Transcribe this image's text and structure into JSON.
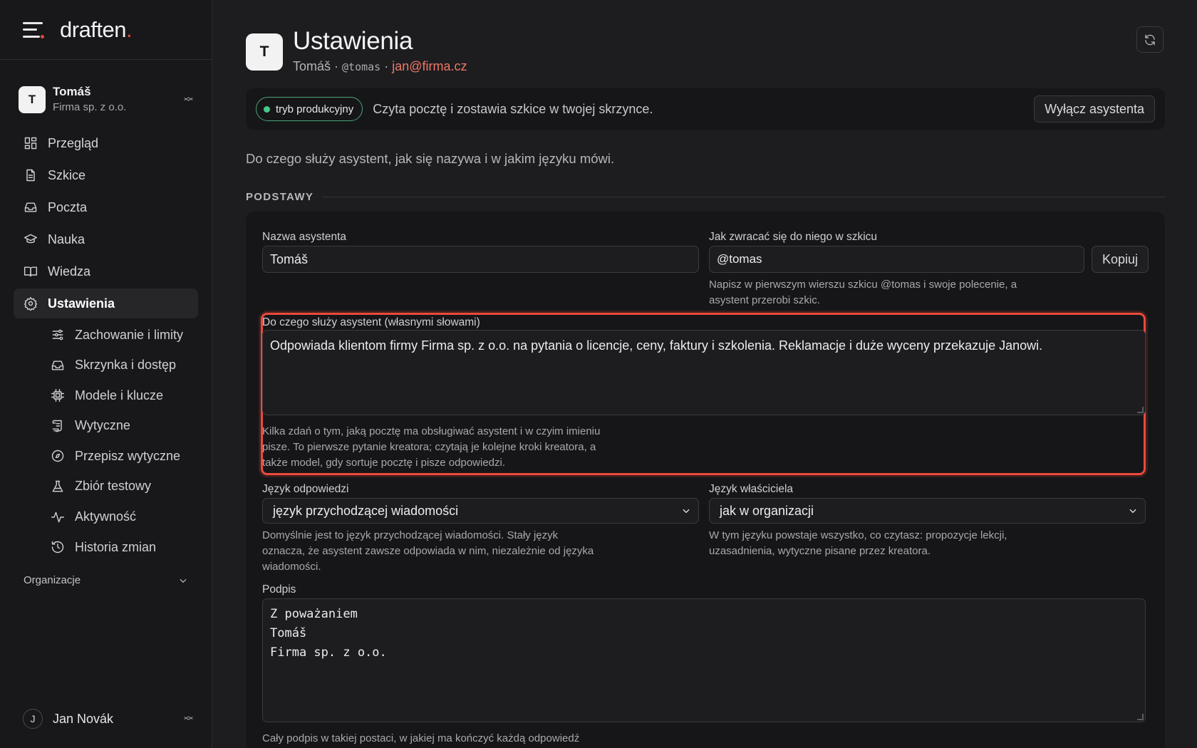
{
  "brand": {
    "name": "draften",
    "dot": "."
  },
  "account": {
    "initial": "T",
    "name": "Tomáš",
    "org": "Firma sp. z o.o."
  },
  "nav": {
    "items": [
      {
        "label": "Przegląd",
        "icon": "dashboard-icon"
      },
      {
        "label": "Szkice",
        "icon": "document-icon"
      },
      {
        "label": "Poczta",
        "icon": "inbox-icon"
      },
      {
        "label": "Nauka",
        "icon": "graduation-cap-icon"
      },
      {
        "label": "Wiedza",
        "icon": "book-icon"
      },
      {
        "label": "Ustawienia",
        "icon": "gear-icon",
        "active": true
      }
    ],
    "subitems": [
      {
        "label": "Zachowanie i limity",
        "icon": "sliders-icon"
      },
      {
        "label": "Skrzynka i dostęp",
        "icon": "inbox-icon"
      },
      {
        "label": "Modele i klucze",
        "icon": "chip-icon"
      },
      {
        "label": "Wytyczne",
        "icon": "scroll-icon"
      },
      {
        "label": "Przepisz wytyczne",
        "icon": "compass-icon"
      },
      {
        "label": "Zbiór testowy",
        "icon": "flask-icon"
      },
      {
        "label": "Aktywność",
        "icon": "activity-icon"
      },
      {
        "label": "Historia zmian",
        "icon": "history-icon"
      }
    ],
    "org_section": "Organizacje"
  },
  "user": {
    "initial": "J",
    "name": "Jan Novák"
  },
  "header": {
    "initial": "T",
    "title": "Ustawienia",
    "name": "Tomáš",
    "sep1": " · ",
    "handle": "@tomas",
    "sep2": " · ",
    "email": "jan@firma.cz"
  },
  "mode": {
    "badge": "tryb produkcyjny",
    "text": "Czyta pocztę i zostawia szkice w twojej skrzynce.",
    "button": "Wyłącz asystenta"
  },
  "intro": "Do czego służy asystent, jak się nazywa i w jakim języku mówi.",
  "section": "PODSTAWY",
  "form": {
    "name_label": "Nazwa asystenta",
    "name_value": "Tomáš",
    "address_label": "Jak zwracać się do niego w szkicu",
    "address_value": "@tomas",
    "copy_button": "Kopiuj",
    "address_help_1": "Napisz w pierwszym wierszu szkicu @tomas i swoje polecenie, a",
    "address_help_2": "asystent przerobi szkic.",
    "purpose_label": "Do czego służy asystent (własnymi słowami)",
    "purpose_value": "Odpowiada klientom firmy Firma sp. z o.o. na pytania o licencje, ceny, faktury i szkolenia. Reklamacje i duże wyceny przekazuje Janowi.",
    "purpose_help_1": "Kilka zdań o tym, jaką pocztę ma obsługiwać asystent i w czyim imieniu",
    "purpose_help_2": "pisze. To pierwsze pytanie kreatora; czytają je kolejne kroki kreatora, a",
    "purpose_help_3": "także model, gdy sortuje pocztę i pisze odpowiedzi.",
    "reply_lang_label": "Język odpowiedzi",
    "reply_lang_value": "język przychodzącej wiadomości",
    "reply_lang_help_1": "Domyślnie jest to język przychodzącej wiadomości. Stały język",
    "reply_lang_help_2": "oznacza, że asystent zawsze odpowiada w nim, niezależnie od języka",
    "reply_lang_help_3": "wiadomości.",
    "owner_lang_label": "Język właściciela",
    "owner_lang_value": "jak w organizacji",
    "owner_lang_help_1": "W tym języku powstaje wszystko, co czytasz: propozycje lekcji,",
    "owner_lang_help_2": "uzasadnienia, wytyczne pisane przez kreatora.",
    "signature_label": "Podpis",
    "signature_line_1": "Z poważaniem",
    "signature_line_2": "Tomáš",
    "signature_line_3": "Firma sp. z o.o.",
    "signature_help": "Cały podpis w takiej postaci, w jakiej ma kończyć każdą odpowiedź"
  },
  "colors": {
    "accent": "#e04a3a",
    "highlight": "#ea4a3c",
    "email": "#f07866",
    "status": "#44c98a"
  }
}
